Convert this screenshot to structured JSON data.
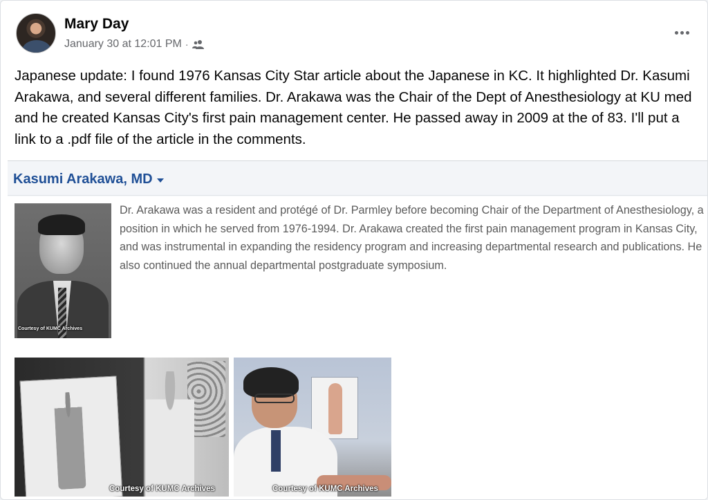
{
  "post": {
    "author": "Mary Day",
    "date": "January 30 at 12:01 PM",
    "separator": "·",
    "audience_icon": "people-icon",
    "more_icon": "more-options-icon",
    "text": "Japanese update: I found 1976 Kansas City Star article about the Japanese in KC. It highlighted Dr. Kasumi Arakawa, and several different families. Dr. Arakawa was the Chair of the Dept of Anesthesiology at KU med and he created Kansas City's first pain management center. He passed away in 2009 at the of 83. I'll put a link to a .pdf file of the article in the comments."
  },
  "embed": {
    "title": "Kasumi Arakawa, MD",
    "bio": "Dr. Arakawa was a resident and protégé of Dr. Parmley before becoming Chair of the Department of Anesthesiology, a position in which he served from 1976-1994. Dr. Arakawa created the first pain management program in Kansas City, and was instrumental in expanding the residency program and increasing departmental research and publications. He also continued the annual departmental postgraduate symposium.",
    "photos": [
      {
        "credit": "Courtesy of KUMC Archives"
      },
      {
        "credit": "Courtesy of KUMC Archives"
      },
      {
        "credit": "Courtesy of KUMC Archives"
      }
    ]
  },
  "colors": {
    "link_blue": "#1f4f96",
    "meta_gray": "#65676b",
    "text_dark": "#050505"
  }
}
